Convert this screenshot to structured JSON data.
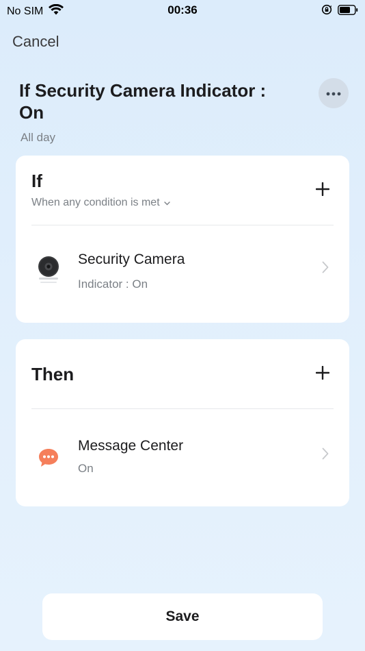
{
  "status_bar": {
    "carrier": "No SIM",
    "time": "00:36"
  },
  "header": {
    "cancel_label": "Cancel",
    "title": "If Security Camera Indicator : On",
    "subtitle": "All day"
  },
  "if_section": {
    "title": "If",
    "condition_mode": "When any condition is met",
    "item": {
      "name": "Security Camera",
      "state": "Indicator : On",
      "icon": "security-camera-icon"
    }
  },
  "then_section": {
    "title": "Then",
    "item": {
      "name": "Message Center",
      "state": "On",
      "icon": "message-center-icon"
    }
  },
  "footer": {
    "save_label": "Save"
  },
  "colors": {
    "background": "#dcecfb",
    "card": "#ffffff",
    "secondary_text": "#7b8086",
    "message_icon": "#f57f5b"
  }
}
